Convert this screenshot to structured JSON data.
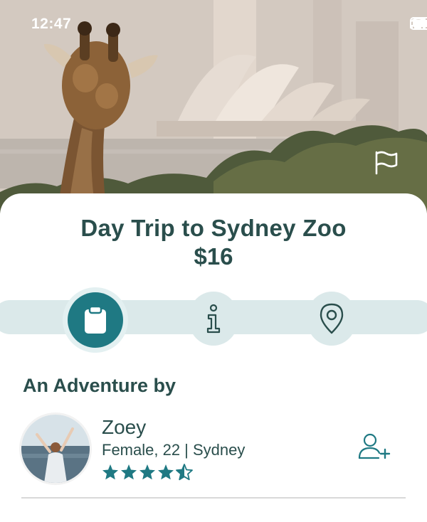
{
  "status_bar": {
    "time": "12:47",
    "icons": [
      "signal-icon",
      "wifi-icon",
      "battery-icon"
    ]
  },
  "hero": {
    "image_description": "",
    "action_icon": "flag-icon"
  },
  "trip": {
    "title": "Day Trip to Sydney Zoo",
    "price": "$16"
  },
  "tabs": [
    {
      "name": "details",
      "icon": "clipboard-icon",
      "active": true
    },
    {
      "name": "info",
      "icon": "info-icon",
      "active": false
    },
    {
      "name": "location",
      "icon": "location-pin-icon",
      "active": false
    }
  ],
  "host_section": {
    "heading": "An Adventure by",
    "host": {
      "name": "Zoey",
      "meta": "Female, 22 | Sydney",
      "rating": 4.5,
      "rating_max": 5
    },
    "add_friend_icon": "add-user-icon"
  },
  "colors": {
    "primary_teal": "#1f7983",
    "text_dark_teal": "#2a4e4c",
    "tab_track": "#dbe9ea"
  }
}
